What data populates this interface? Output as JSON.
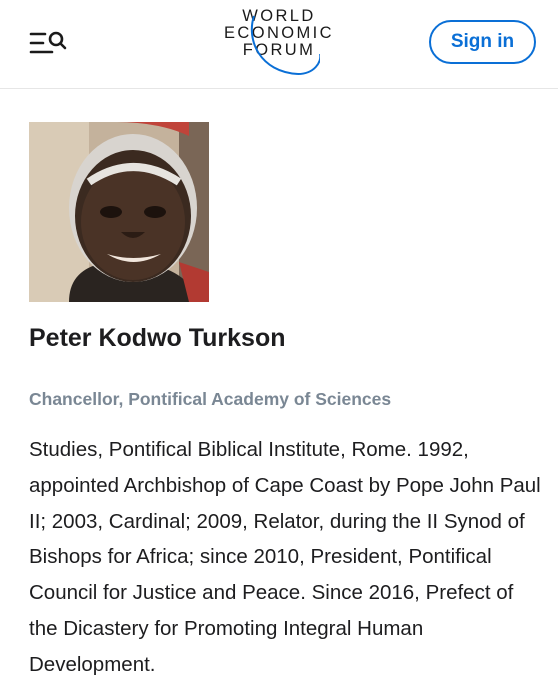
{
  "header": {
    "logo_lines": [
      "WORLD",
      "ECONOMIC",
      "FORUM"
    ],
    "menu_icon": "menu-search-icon",
    "signin_label": "Sign in",
    "accent_color": "#0a6fd6"
  },
  "profile": {
    "name": "Peter Kodwo Turkson",
    "role": "Chancellor, Pontifical Academy of Sciences",
    "bio": "Studies, Pontifical Biblical Institute, Rome. 1992, appointed Archbishop of Cape Coast by Pope John Paul II; 2003, Cardinal; 2009, Relator, during the II Synod of Bishops for Africa; since 2010, President, Pontifical Council for Justice and Peace. Since 2016, Prefect of the Dicastery for Promoting Integral Human Development."
  }
}
